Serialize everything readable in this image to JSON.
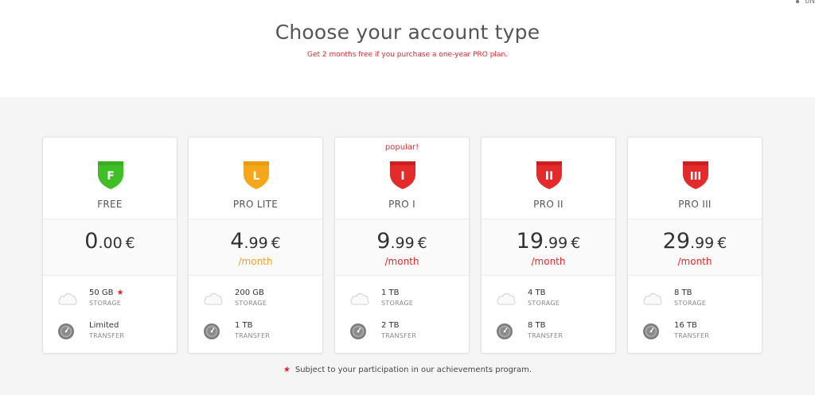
{
  "corner_text": "bN",
  "header": {
    "title": "Choose your account type",
    "subtitle": "Get 2 months free if you purchase a one-year PRO plan."
  },
  "colors": {
    "accent_red": "#e32b2b",
    "free_green": "#3fbf25",
    "lite_orange": "#f4a71b",
    "per_month_orange": "#f0a12a",
    "per_month_red": "#e32b2b"
  },
  "plans": [
    {
      "name": "FREE",
      "badge_letter": "F",
      "badge_icon": "shield-free-icon",
      "price_main": "0",
      "price_cents": ".00",
      "currency": "€",
      "per": "",
      "storage_value": "50 GB",
      "storage_label": "STORAGE",
      "transfer_value": "Limited",
      "transfer_label": "TRANSFER"
    },
    {
      "name": "PRO LITE",
      "badge_letter": "L",
      "badge_icon": "shield-pro-lite-icon",
      "price_main": "4",
      "price_cents": ".99",
      "currency": "€",
      "per": "/month",
      "storage_value": "200 GB",
      "storage_label": "STORAGE",
      "transfer_value": "1 TB",
      "transfer_label": "TRANSFER"
    },
    {
      "name": "PRO I",
      "badge_letter": "I",
      "badge_icon": "shield-pro-1-icon",
      "tag": "popular!",
      "price_main": "9",
      "price_cents": ".99",
      "currency": "€",
      "per": "/month",
      "storage_value": "1 TB",
      "storage_label": "STORAGE",
      "transfer_value": "2 TB",
      "transfer_label": "TRANSFER"
    },
    {
      "name": "PRO II",
      "badge_letter": "II",
      "badge_icon": "shield-pro-2-icon",
      "price_main": "19",
      "price_cents": ".99",
      "currency": "€",
      "per": "/month",
      "storage_value": "4 TB",
      "storage_label": "STORAGE",
      "transfer_value": "8 TB",
      "transfer_label": "TRANSFER"
    },
    {
      "name": "PRO III",
      "badge_letter": "III",
      "badge_icon": "shield-pro-3-icon",
      "price_main": "29",
      "price_cents": ".99",
      "currency": "€",
      "per": "/month",
      "storage_value": "8 TB",
      "storage_label": "STORAGE",
      "transfer_value": "16 TB",
      "transfer_label": "TRANSFER"
    }
  ],
  "footnote": {
    "star": "★",
    "text": "Subject to your participation in our achievements program."
  }
}
